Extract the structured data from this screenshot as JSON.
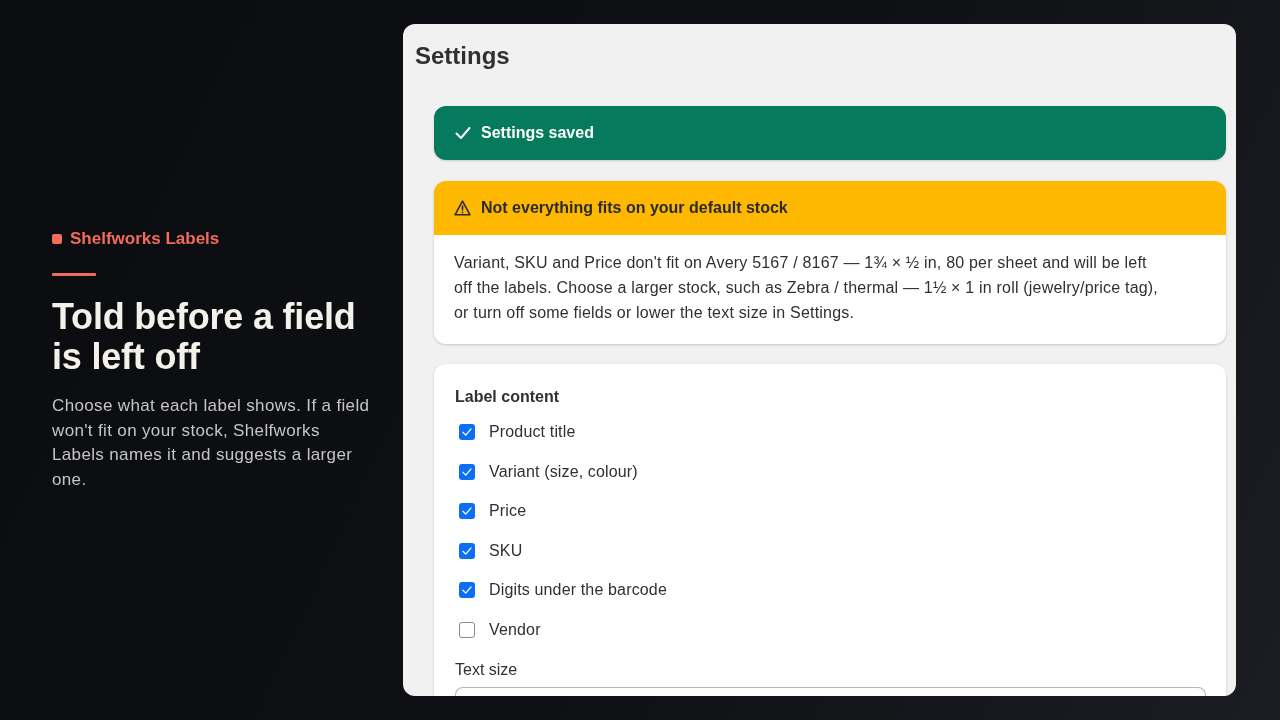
{
  "brand": {
    "name": "Shelfworks Labels"
  },
  "hero": {
    "title": "Told before a field is left off",
    "description": "Choose what each label shows. If a field won't fit on your stock, Shelfworks Labels names it and suggests a larger one."
  },
  "settings": {
    "title": "Settings",
    "notices": [
      {
        "kind": "success",
        "title": "Settings saved"
      },
      {
        "kind": "warning",
        "title": "Not everything fits on your default stock",
        "body": "Variant, SKU and Price don't fit on Avery 5167 / 8167 — 1¾ × ½ in, 80 per sheet and will be left off the labels. Choose a larger stock, such as Zebra / thermal — 1½ × 1 in roll (jewelry/price tag), or turn off some fields or lower the text size in Settings."
      }
    ],
    "label_content": {
      "heading": "Label content",
      "fields": [
        {
          "label": "Product title",
          "checked": true
        },
        {
          "label": "Variant (size, colour)",
          "checked": true
        },
        {
          "label": "Price",
          "checked": true
        },
        {
          "label": "SKU",
          "checked": true
        },
        {
          "label": "Digits under the barcode",
          "checked": true
        },
        {
          "label": "Vendor",
          "checked": false
        }
      ]
    },
    "text_size": {
      "label": "Text size"
    }
  }
}
